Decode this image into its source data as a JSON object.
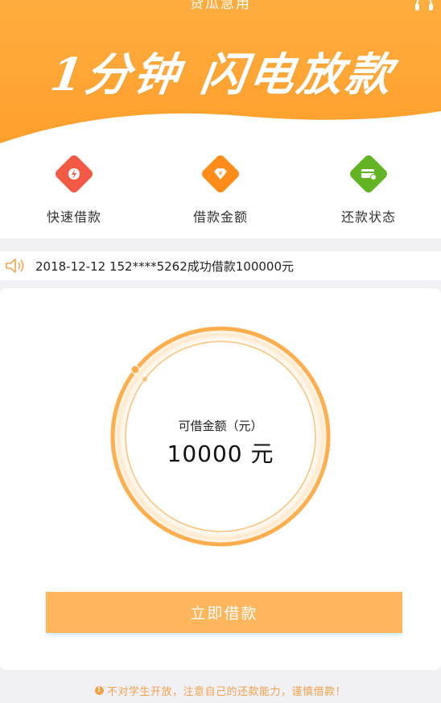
{
  "header": {
    "app_title": "贷瓜急用",
    "slogan": "1分钟 闪电放款",
    "headset_icon": "customer-service-icon"
  },
  "features": [
    {
      "label": "快速借款",
      "icon": "lightning-icon",
      "color": "#f35a45"
    },
    {
      "label": "借款金额",
      "icon": "yen-diamond-icon",
      "color": "#ff8c1a"
    },
    {
      "label": "还款状态",
      "icon": "card-icon",
      "color": "#63b425"
    }
  ],
  "notice": {
    "icon": "speaker-icon",
    "text": "2018-12-12 152****5262成功借款100000元"
  },
  "loan": {
    "amount_label": "可借金额（元）",
    "amount_value": "10000 元",
    "button_label": "立即借款"
  },
  "footer": {
    "tip": "不对学生开放，注意自己的还款能力，谨慎借款！"
  },
  "colors": {
    "brand": "#ffa136",
    "button": "#ffb55c",
    "tip": "#f2a24a"
  }
}
